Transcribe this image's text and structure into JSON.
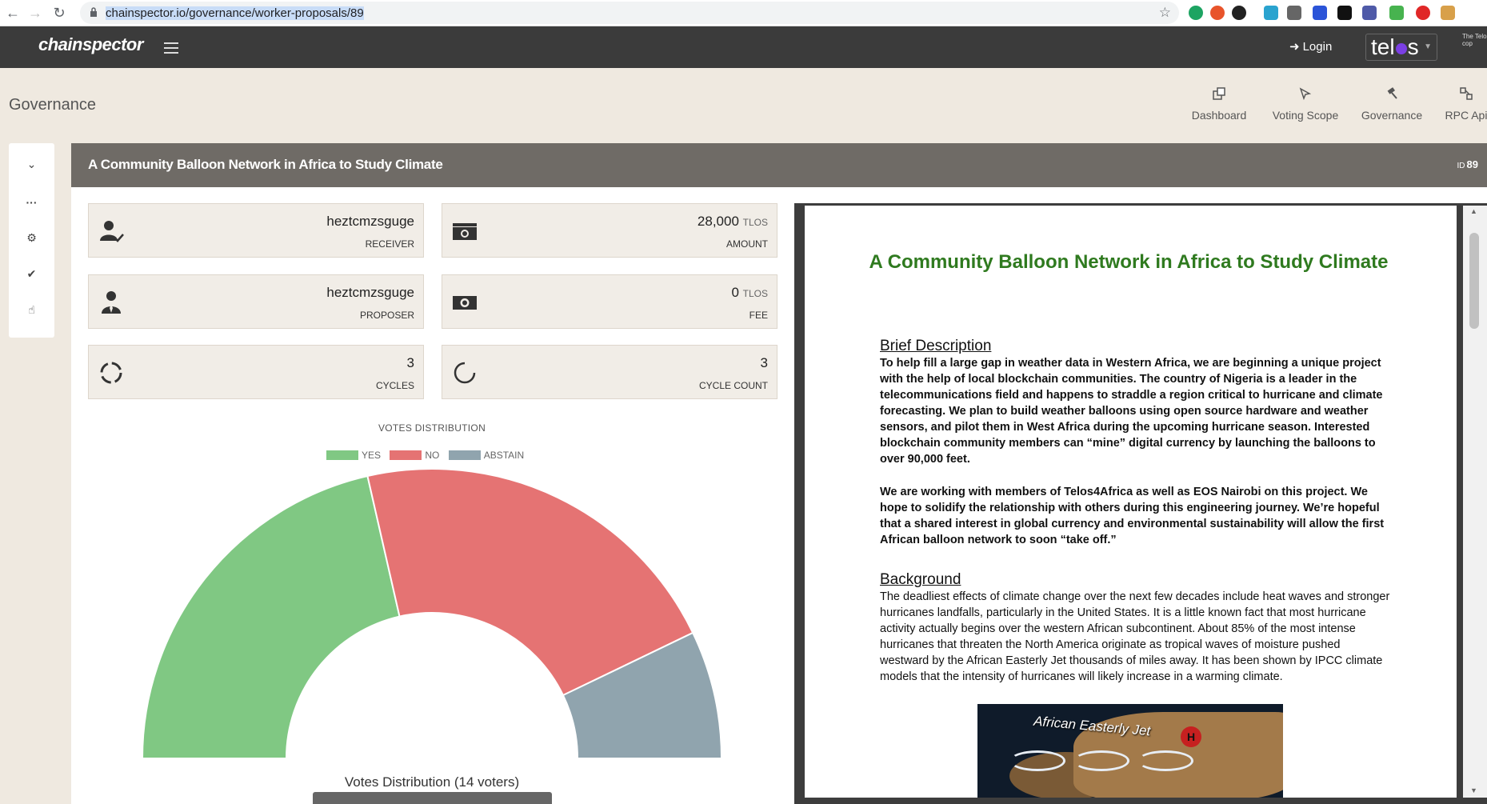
{
  "browser": {
    "url_host": "chainspector.io",
    "url_path": "/governance/worker-proposals/89"
  },
  "header": {
    "logo": "chainspector",
    "login_label": "Login",
    "network": "telos",
    "corner_text": "The Telo cop"
  },
  "page": {
    "title": "Governance",
    "nav": [
      {
        "label": "Dashboard",
        "icon": "external-link-icon"
      },
      {
        "label": "Voting Scope",
        "icon": "cursor-select-icon"
      },
      {
        "label": "Governance",
        "icon": "gavel-icon"
      },
      {
        "label": "RPC Api",
        "icon": "network-icon"
      }
    ]
  },
  "sidebar": {
    "icons": [
      "chevron-down-icon",
      "ellipsis-icon",
      "gear-icon",
      "check-icon",
      "hand-pointer-icon"
    ]
  },
  "proposal": {
    "title": "A Community Balloon Network in Africa to Study Climate",
    "id_label": "ID",
    "id": "89",
    "cards": [
      {
        "value": "heztcmzsguge",
        "unit": "",
        "label": "RECEIVER",
        "icon": "user-check-icon"
      },
      {
        "value": "28,000",
        "unit": "TLOS",
        "label": "AMOUNT",
        "icon": "money-stack-icon"
      },
      {
        "value": "heztcmzsguge",
        "unit": "",
        "label": "PROPOSER",
        "icon": "user-tie-icon"
      },
      {
        "value": "0",
        "unit": "TLOS",
        "label": "FEE",
        "icon": "money-bill-icon"
      },
      {
        "value": "3",
        "unit": "",
        "label": "CYCLES",
        "icon": "circle-dashed-icon"
      },
      {
        "value": "3",
        "unit": "",
        "label": "CYCLE COUNT",
        "icon": "spinner-icon"
      }
    ]
  },
  "votes": {
    "title": "VOTES DISTRIBUTION",
    "caption": "Votes Distribution (14 voters)"
  },
  "chart_data": {
    "type": "pie",
    "variant": "half-doughnut",
    "title": "VOTES DISTRIBUTION",
    "legend_position": "top",
    "categories": [
      "YES",
      "NO",
      "ABSTAIN"
    ],
    "values": [
      6,
      6,
      2
    ],
    "colors": [
      "#80c883",
      "#e57373",
      "#90a4ae"
    ]
  },
  "document": {
    "title": "A Community Balloon Network in Africa to Study Climate",
    "brief_heading": "Brief Description",
    "brief_p1": "To help fill a large gap in weather data in Western Africa, we are beginning a unique project with the help of local blockchain communities. The country of Nigeria is a leader in the telecommunications field and happens to straddle a region critical to hurricane and climate forecasting. We plan to build weather balloons using open source hardware and weather sensors, and pilot them in West Africa during the upcoming hurricane season. Interested blockchain community members can “mine” digital currency by launching the balloons to over 90,000 feet.",
    "brief_p2": "We are working with members of Telos4Africa as well as EOS Nairobi on this project. We hope to solidify the relationship with others during this engineering journey. We’re hopeful that a shared interest in global currency and environmental sustainability will allow the first African balloon network to soon “take off.”",
    "background_heading": "Background",
    "background_p": "The deadliest effects of climate change over the next few decades include heat waves and stronger hurricanes landfalls, particularly in the United States. It is a little known fact that most hurricane activity actually begins over the western African subcontinent. About 85% of the most intense hurricanes that threaten the North America originate as tropical waves of moisture pushed westward by the African Easterly Jet thousands of miles away. It has been shown by IPCC climate models that the intensity of hurricanes will likely increase in a warming climate.",
    "image_label": "African Easterly Jet",
    "image_marker": "H"
  }
}
